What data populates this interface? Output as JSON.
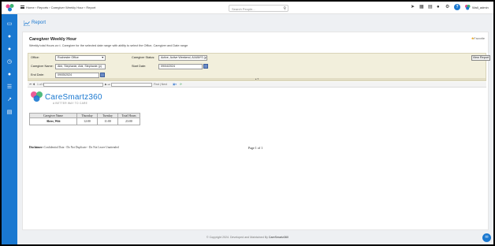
{
  "topbar": {
    "breadcrumb": [
      "Home",
      "Reports",
      "Caregiver Weekly Hour",
      "Report"
    ],
    "search_placeholder": "Search People...",
    "icons": [
      "send-icon",
      "calendar-icon",
      "grid-icon",
      "bell-icon",
      "gear-icon",
      "help-icon"
    ],
    "help_label": "?",
    "username": "Wall_admin"
  },
  "sidebar": {
    "items": [
      "id-card-icon",
      "user-icon",
      "user-alt-icon",
      "clock-icon",
      "users-icon",
      "user-list-icon",
      "chart-icon",
      "id-badge-icon"
    ]
  },
  "page": {
    "title": "Report"
  },
  "report": {
    "title": "Caregiver Weekly Hour",
    "description": "Weekly total Hours w.r.t. Caregiver for the selected date range with ability to select the Office, Caregiver and Date range",
    "favorite_label": "Favorite",
    "filters": {
      "office_label": "Office:",
      "office_value": "Rochester Office",
      "caregiver_status_label": "Caregiver Status:",
      "caregiver_status_value": "Active, Active Weekend, ALWAYS (p)",
      "caregiver_name_label": "Caregiver Name:",
      "caregiver_name_value": "Abir, Stephanie, Abir, Stephanie (p)",
      "start_date_label": "Start Date:",
      "start_date_value": "09/04/2024",
      "end_date_label": "End Date:",
      "end_date_value": "09/05/2024",
      "view_button": "View Report"
    },
    "toolbar": {
      "page_of": "1 of 1",
      "find_next": "Find | Next"
    },
    "brand": {
      "name": "CareSmartz360",
      "tagline": "A BETTER WAY TO CARE"
    },
    "table": {
      "columns": [
        "Caregiver Name",
        "Thursday",
        "Tuesday",
        "Total Hours"
      ],
      "rows": [
        [
          "Abter, Wiii",
          "12:00",
          "11:00",
          "23:00"
        ]
      ]
    },
    "disclaimer_label": "Disclaimer:",
    "disclaimer_text": "Confidential Data - Do Not Duplicate - Do Not Leave Unattended",
    "pager": "Page 1 of 1"
  },
  "footer": {
    "copyright": "© Copyright 2024. Developed and Maintained By",
    "company": "CareSmartz360"
  },
  "colors": {
    "primary": "#1a78d0",
    "filter_bg": "#f2efdc",
    "favorite_star": "#e8a317"
  }
}
